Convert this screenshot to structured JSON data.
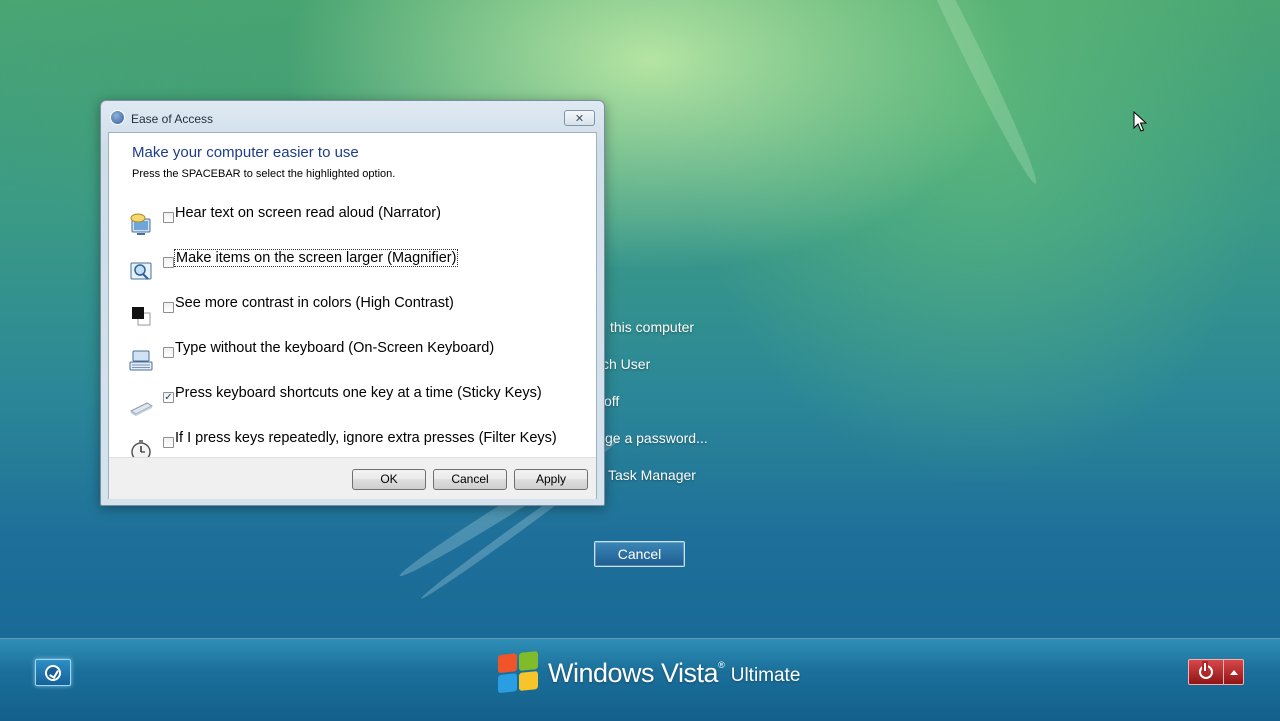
{
  "dialog": {
    "title": "Ease of Access",
    "close_label": "✕",
    "heading": "Make your computer easier to use",
    "subtext": "Press the SPACEBAR to select the highlighted option.",
    "options": [
      {
        "label": "Hear text on screen read aloud (Narrator)",
        "checked": false,
        "icon": "narrator-icon"
      },
      {
        "label": "Make items on the screen larger (Magnifier)",
        "checked": false,
        "icon": "magnifier-icon"
      },
      {
        "label": "See more contrast in colors (High Contrast)",
        "checked": false,
        "icon": "high-contrast-icon"
      },
      {
        "label": "Type without the keyboard (On-Screen Keyboard)",
        "checked": false,
        "icon": "keyboard-icon"
      },
      {
        "label": "Press keyboard shortcuts one key at a time (Sticky Keys)",
        "checked": true,
        "icon": "sticky-keys-icon"
      },
      {
        "label": "If I press keys repeatedly, ignore extra presses (Filter Keys)",
        "checked": false,
        "icon": "filter-keys-icon"
      }
    ],
    "check_mark": "✓",
    "buttons": {
      "ok": "OK",
      "cancel": "Cancel",
      "apply": "Apply"
    }
  },
  "background_menu": {
    "items": [
      "this computer",
      "ch User",
      "off",
      "ge a password...",
      "Task Manager"
    ],
    "cancel_label": "Cancel"
  },
  "bottom_bar": {
    "brand": "Windows Vista",
    "trademark": "®",
    "edition": "Ultimate"
  },
  "colors": {
    "heading": "#1e3e8a",
    "power_button": "#b52326",
    "background_top": "#4aa673",
    "background_bottom": "#176594"
  }
}
